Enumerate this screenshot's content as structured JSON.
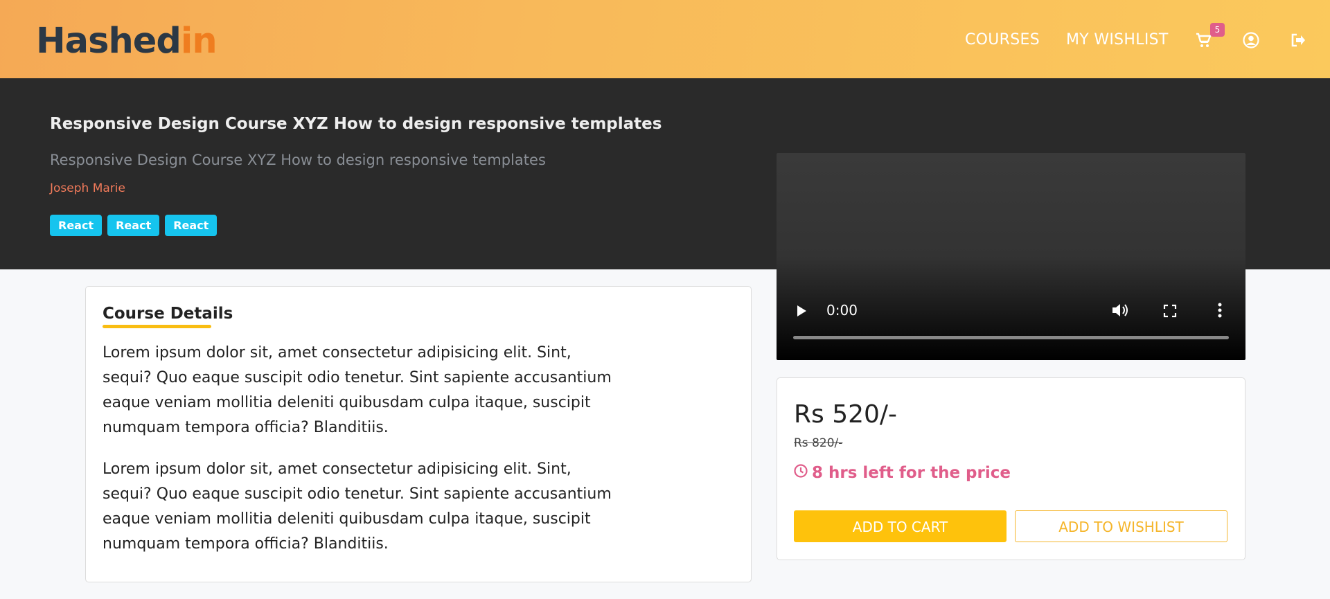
{
  "header": {
    "logo_text_main": "Hashed",
    "logo_text_accent": "in",
    "nav_courses": "COURSES",
    "nav_wishlist": "MY WISHLIST",
    "cart_count": "5",
    "icons": [
      "cart-icon",
      "user-circle-icon",
      "sign-out-icon"
    ]
  },
  "banner": {
    "title": "Responsive Design Course XYZ How to design responsive templates",
    "subtitle": "Responsive Design Course XYZ How to design responsive templates",
    "author": "Joseph Marie",
    "tags": [
      "React",
      "React",
      "React"
    ]
  },
  "video": {
    "time": "0:00",
    "icons": [
      "play-icon",
      "volume-icon",
      "fullscreen-icon",
      "more-options-icon"
    ]
  },
  "details": {
    "heading": "Course Details",
    "paragraphs": [
      "Lorem ipsum dolor sit, amet consectetur adipisicing elit. Sint, sequi? Quo eaque suscipit odio tenetur. Sint sapiente accusantium eaque veniam mollitia deleniti quibusdam culpa itaque, suscipit numquam tempora officia? Blanditiis.",
      "Lorem ipsum dolor sit, amet consectetur adipisicing elit. Sint, sequi? Quo eaque suscipit odio tenetur. Sint sapiente accusantium eaque veniam mollitia deleniti quibusdam culpa itaque, suscipit numquam tempora officia? Blanditiis."
    ]
  },
  "pricing": {
    "price": "Rs 520/-",
    "old_price": "Rs 820/-",
    "timer": "8 hrs left for the price",
    "add_to_cart": "ADD TO CART",
    "add_to_wishlist": "ADD TO WISHLIST"
  },
  "colors": {
    "header_gradient_start": "#f5a955",
    "header_gradient_end": "#fbc95c",
    "banner_bg": "#2a2a2a",
    "tag_bg": "#16c4ee",
    "accent_yellow": "#fec20c",
    "timer_pink": "#e05d8a",
    "author_color": "#f07a5a"
  }
}
